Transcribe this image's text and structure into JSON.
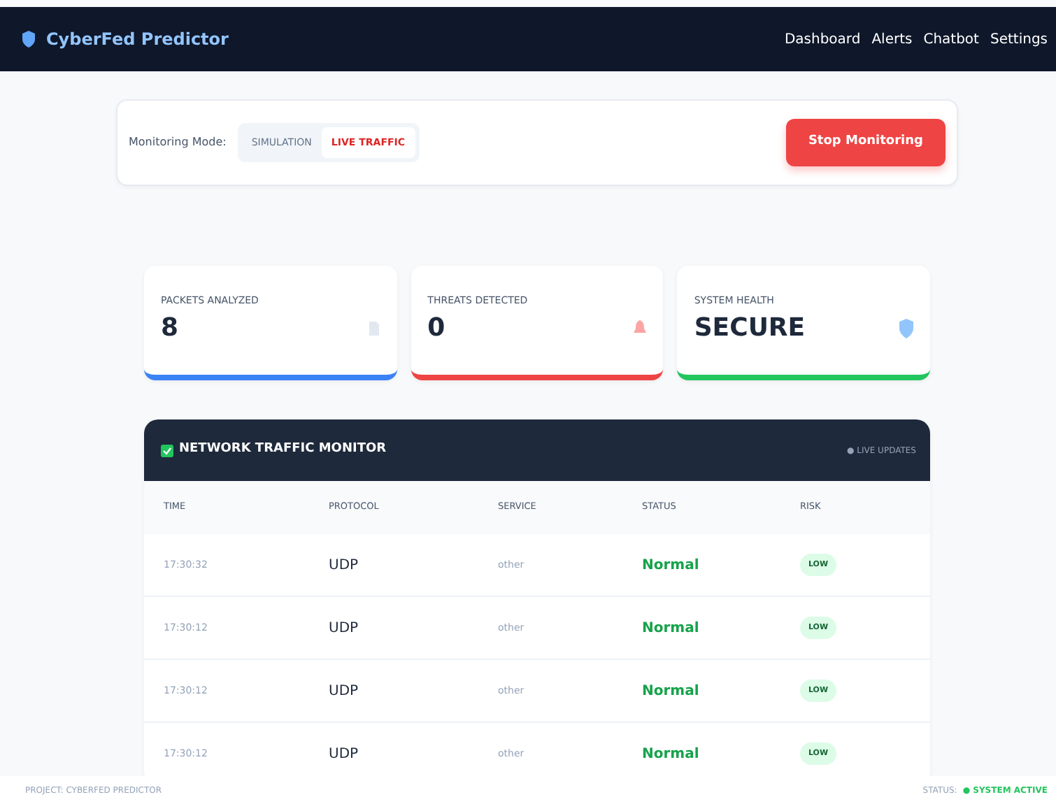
{
  "navbar": {
    "brand": "CyberFed Predictor",
    "links": [
      "Dashboard",
      "Alerts",
      "Chatbot",
      "Settings"
    ]
  },
  "control_panel": {
    "label": "Monitoring Mode:",
    "modes": [
      {
        "label": "SIMULATION",
        "selected": false
      },
      {
        "label": "LIVE TRAFFIC",
        "selected": true
      }
    ],
    "stop_button": "Stop Monitoring"
  },
  "stats": [
    {
      "label": "PACKETS ANALYZED",
      "value": "8",
      "color": "#3b82f6",
      "kind": "packets"
    },
    {
      "label": "THREATS DETECTED",
      "value": "0",
      "color": "#ef4444",
      "kind": "threats"
    },
    {
      "label": "SYSTEM HEALTH",
      "value": "SECURE",
      "color": "#22c55e",
      "kind": "health"
    }
  ],
  "traffic_monitor": {
    "title": "NETWORK TRAFFIC MONITOR",
    "live_label": "● LIVE UPDATES",
    "columns": [
      "TIME",
      "PROTOCOL",
      "SERVICE",
      "STATUS",
      "RISK"
    ],
    "rows": [
      {
        "time": "17:30:32",
        "protocol": "UDP",
        "service": "other",
        "status": "Normal",
        "risk": "LOW"
      },
      {
        "time": "17:30:12",
        "protocol": "UDP",
        "service": "other",
        "status": "Normal",
        "risk": "LOW"
      },
      {
        "time": "17:30:12",
        "protocol": "UDP",
        "service": "other",
        "status": "Normal",
        "risk": "LOW"
      },
      {
        "time": "17:30:12",
        "protocol": "UDP",
        "service": "other",
        "status": "Normal",
        "risk": "LOW"
      }
    ]
  },
  "footer": {
    "project": "PROJECT: CYBERFED PREDICTOR",
    "status_label": "STATUS:",
    "status_value": "● SYSTEM ACTIVE"
  }
}
